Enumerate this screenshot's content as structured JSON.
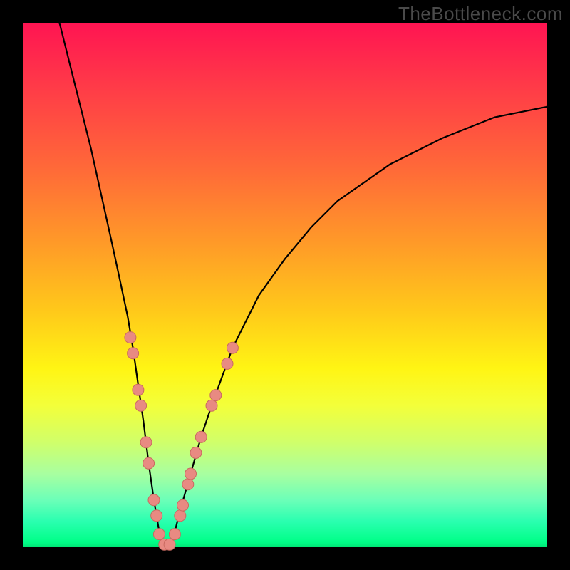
{
  "watermark": "TheBottleneck.com",
  "colors": {
    "frame": "#000000",
    "gradient_top": "#ff1452",
    "gradient_bottom": "#00e676",
    "curve": "#000000",
    "dot_fill": "#e88a82",
    "dot_stroke": "#c96a60"
  },
  "chart_data": {
    "type": "line",
    "title": "",
    "xlabel": "",
    "ylabel": "",
    "xlim": [
      0,
      100
    ],
    "ylim": [
      0,
      100
    ],
    "series": [
      {
        "name": "bottleneck-curve",
        "x": [
          7,
          10,
          13,
          15,
          17,
          18.5,
          20,
          21,
          22,
          23,
          24,
          25,
          26,
          27,
          28,
          29,
          30,
          32,
          34,
          36,
          40,
          45,
          50,
          55,
          60,
          70,
          80,
          90,
          100
        ],
        "y": [
          100,
          88,
          76,
          67,
          58,
          51,
          44,
          38,
          31,
          24,
          16,
          9,
          3,
          0,
          0,
          3,
          7,
          14,
          21,
          27,
          38,
          48,
          55,
          61,
          66,
          73,
          78,
          82,
          84
        ]
      }
    ],
    "scatter": [
      {
        "name": "data-points",
        "points": [
          {
            "x": 20.5,
            "y": 40
          },
          {
            "x": 21.0,
            "y": 37
          },
          {
            "x": 22.0,
            "y": 30
          },
          {
            "x": 22.5,
            "y": 27
          },
          {
            "x": 23.5,
            "y": 20
          },
          {
            "x": 24.0,
            "y": 16
          },
          {
            "x": 25.0,
            "y": 9
          },
          {
            "x": 25.5,
            "y": 6
          },
          {
            "x": 26.0,
            "y": 2.5
          },
          {
            "x": 27.0,
            "y": 0.5
          },
          {
            "x": 28.0,
            "y": 0.5
          },
          {
            "x": 29.0,
            "y": 2.5
          },
          {
            "x": 30.0,
            "y": 6
          },
          {
            "x": 30.5,
            "y": 8
          },
          {
            "x": 31.5,
            "y": 12
          },
          {
            "x": 32.0,
            "y": 14
          },
          {
            "x": 33.0,
            "y": 18
          },
          {
            "x": 34.0,
            "y": 21
          },
          {
            "x": 36.0,
            "y": 27
          },
          {
            "x": 36.8,
            "y": 29
          },
          {
            "x": 39.0,
            "y": 35
          },
          {
            "x": 40.0,
            "y": 38
          }
        ]
      }
    ]
  }
}
